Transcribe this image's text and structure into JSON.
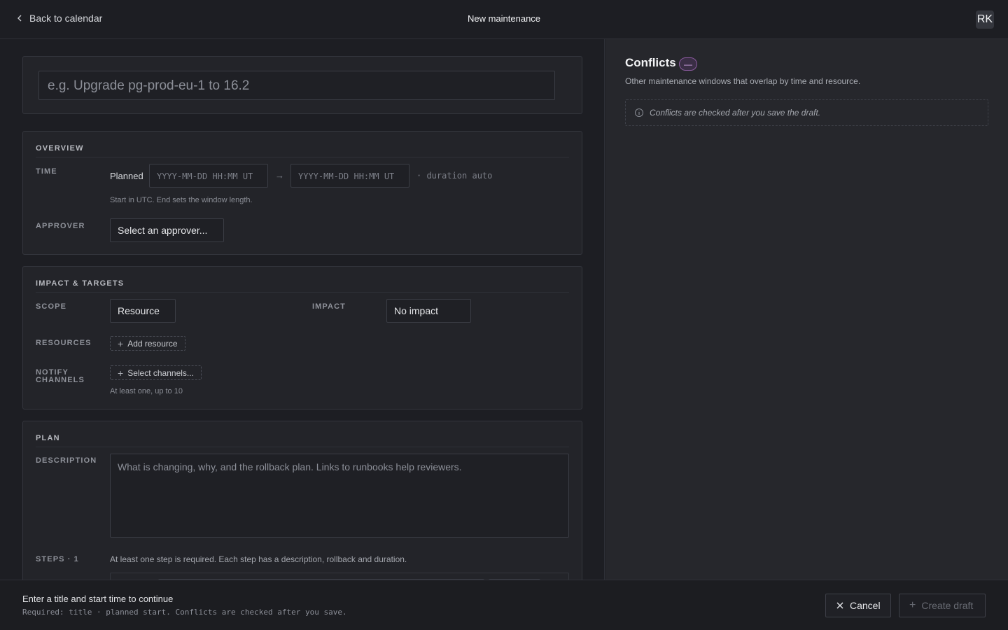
{
  "header": {
    "back_label": "Back to calendar",
    "title": "New maintenance",
    "avatar_initials": "RK"
  },
  "form": {
    "title_placeholder": "e.g. Upgrade pg-prod-eu-1 to 16.2",
    "overview": {
      "heading": "OVERVIEW",
      "time_label": "TIME",
      "planned_label": "Planned",
      "start_placeholder": "YYYY-MM-DD HH:MM UT",
      "arrow": "→",
      "end_placeholder": "YYYY-MM-DD HH:MM UT",
      "duration_text": "· duration auto",
      "time_hint": "Start in UTC. End sets the window length.",
      "approver_label": "APPROVER",
      "approver_value": "Select an approver..."
    },
    "impact": {
      "heading": "IMPACT & TARGETS",
      "scope_label": "SCOPE",
      "scope_value": "Resource",
      "impact_label": "IMPACT",
      "impact_value": "No impact",
      "resources_label": "RESOURCES",
      "add_resource": "Add resource",
      "notify_label_1": "NOTIFY",
      "notify_label_2": "CHANNELS",
      "select_channels": "Select channels...",
      "channels_hint": "At least one, up to 10"
    },
    "plan": {
      "heading": "PLAN",
      "description_label": "DESCRIPTION",
      "description_placeholder": "What is changing, why, and the rollback plan. Links to runbooks help reviewers.",
      "steps_label": "STEPS · 1",
      "steps_hint": "At least one step is required. Each step has a description, rollback and duration."
    }
  },
  "conflicts": {
    "title": "Conflicts",
    "badge": "—",
    "subtitle": "Other maintenance windows that overlap by time and resource.",
    "notice": "Conflicts are checked after you save the draft."
  },
  "footer": {
    "status": "Enter a title and start time to continue",
    "required": "Required: title · planned start. Conflicts are checked after you save.",
    "cancel_label": "Cancel",
    "create_label": "Create draft"
  },
  "colors": {
    "background": "#1d1e23",
    "panel": "#232429",
    "accent_badge": "#8a5a9e"
  }
}
